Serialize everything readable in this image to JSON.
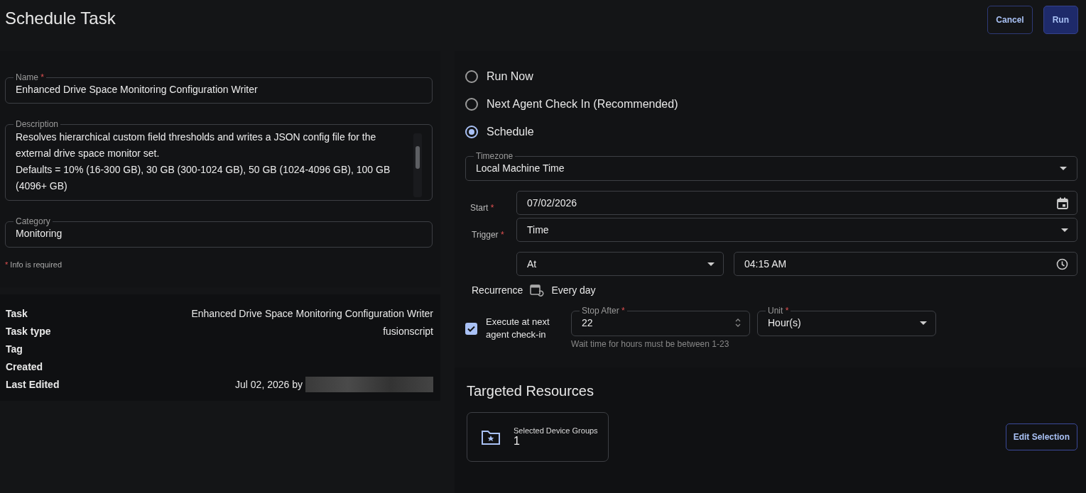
{
  "header": {
    "title": "Schedule Task",
    "buttons": [
      {
        "label": "Cancel",
        "kind": "outline"
      },
      {
        "label": "Run",
        "kind": "primary"
      }
    ]
  },
  "form": {
    "fields": [
      {
        "label": "Name",
        "required_mark": "*",
        "value": "Enhanced Drive Space Monitoring Configuration Writer",
        "kind": "text"
      },
      {
        "label": "Description",
        "value": "Resolves hierarchical custom field thresholds and writes a JSON config file for the external drive space monitor set.\nDefaults = 10% (16-300 GB), 30 GB (300-1024 GB), 50 GB (1024-4096 GB), 100 GB (4096+ GB)",
        "kind": "textarea"
      },
      {
        "label": "Category",
        "value": "Monitoring",
        "kind": "text"
      }
    ],
    "required_note": {
      "mark": "*",
      "text": "Info is required"
    }
  },
  "details": [
    {
      "label": "Task",
      "value": "Enhanced Drive Space Monitoring Configuration Writer"
    },
    {
      "label": "Task type",
      "value": "fusionscript"
    },
    {
      "label": "Tag"
    },
    {
      "label": "Created"
    },
    {
      "label": "Last Edited",
      "value": "Jul 02, 2026 by",
      "redacted": true
    }
  ],
  "schedule": {
    "options": [
      {
        "label": "Run Now",
        "selected": false
      },
      {
        "label": "Next Agent Check In (Recommended)",
        "selected": false
      },
      {
        "label": "Schedule",
        "selected": true
      }
    ],
    "timezone": {
      "label": "Timezone",
      "value": "Local Machine Time"
    },
    "start": {
      "label": "Start",
      "mark": "*",
      "value": "07/02/2026"
    },
    "trigger": {
      "label": "Trigger",
      "mark": "*",
      "value": "Time"
    },
    "at": {
      "value": "At"
    },
    "time": {
      "value": "04:15 AM"
    },
    "recurrence": {
      "label": "Recurrence",
      "value": "Every day"
    },
    "execute": {
      "label": "Execute at next agent check-in",
      "checked": true
    },
    "stop_after": {
      "label": "Stop After",
      "mark": "*",
      "value": "22",
      "hint": "Wait time for hours must be between 1-23"
    },
    "unit": {
      "label": "Unit",
      "mark": "*",
      "value": "Hour(s)"
    }
  },
  "targets": {
    "title": "Targeted Resources",
    "card": {
      "label": "Selected Device Groups",
      "count": "1"
    },
    "button": "Edit Selection"
  }
}
